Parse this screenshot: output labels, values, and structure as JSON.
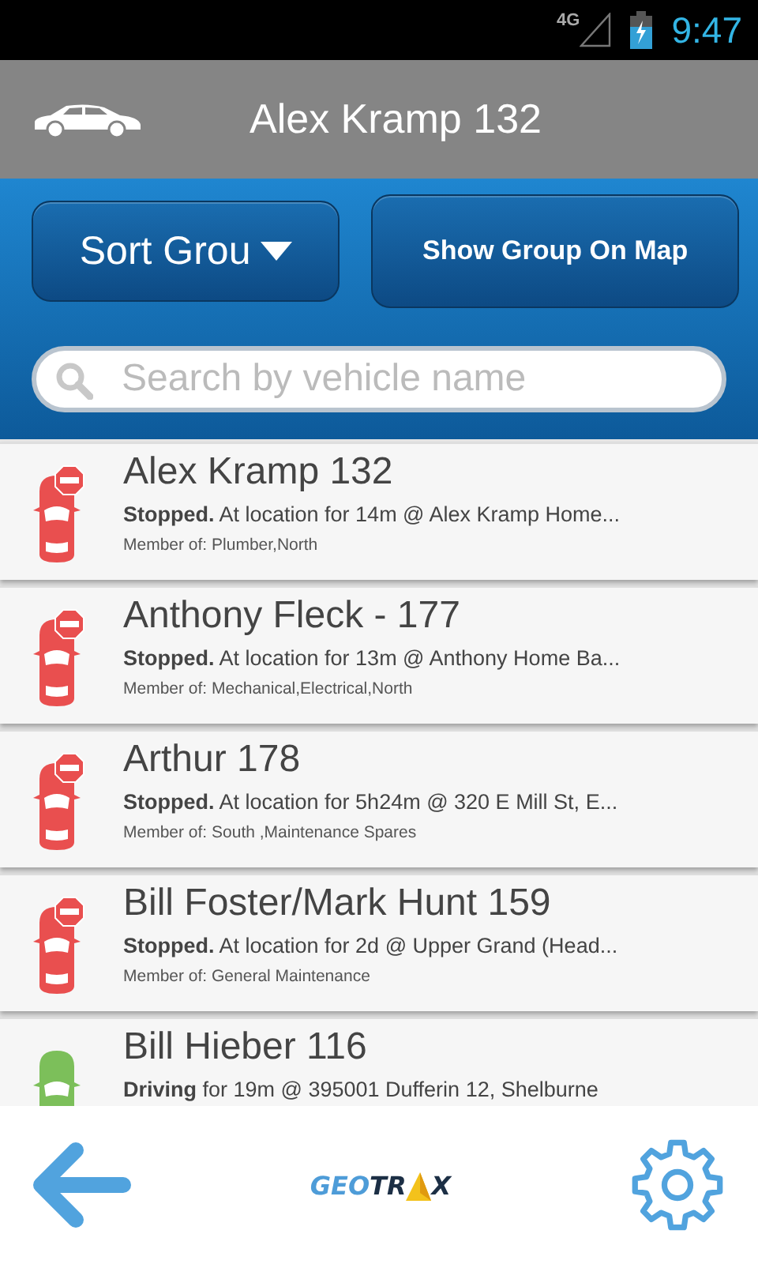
{
  "status_bar": {
    "network": "4G",
    "time": "9:47"
  },
  "header": {
    "title": "Alex Kramp 132"
  },
  "toolbar": {
    "sort_button": "Sort Grou",
    "map_button": "Show Group On Map"
  },
  "search": {
    "placeholder": "Search by vehicle name"
  },
  "vehicles": [
    {
      "name": "Alex Kramp 132",
      "kind": "stopped",
      "detail": "**Stopped.** At location for 14m @ Alex Kramp Home...",
      "groups": "Member of: Plumber,North"
    },
    {
      "name": "Anthony Fleck - 177",
      "kind": "stopped",
      "detail": "**Stopped.** At location for 13m @ Anthony Home Ba...",
      "groups": "Member of: Mechanical,Electrical,North"
    },
    {
      "name": "Arthur 178",
      "kind": "stopped",
      "detail": "**Stopped.** At location for 5h24m @ 320 E Mill St, E...",
      "groups": "Member of: South ,Maintenance Spares"
    },
    {
      "name": "Bill Foster/Mark Hunt 159",
      "kind": "stopped",
      "detail": "**Stopped.** At location for 2d @ Upper Grand (Head...",
      "groups": "Member of: General Maintenance"
    },
    {
      "name": "Bill Hieber 116",
      "kind": "driving",
      "detail": "**Driving** for 19m @ 395001 Dufferin 12, Shelburne"
    }
  ],
  "footer": {
    "logo": [
      "GEO",
      "TR",
      "X"
    ]
  }
}
